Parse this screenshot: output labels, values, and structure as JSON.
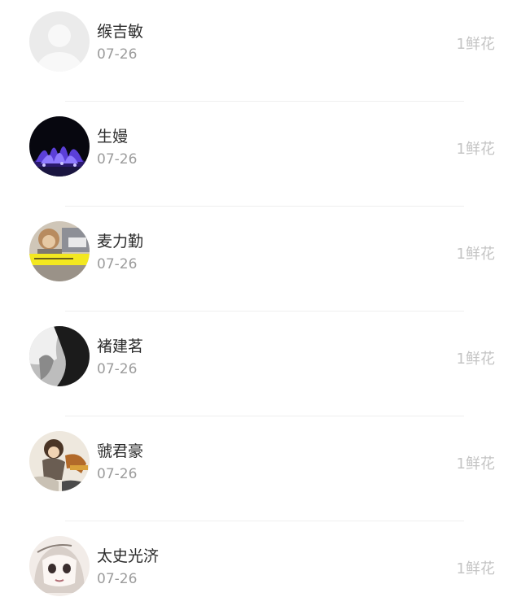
{
  "list": {
    "items": [
      {
        "name": "缑吉敏",
        "date": "07-26",
        "flowers": "1鲜花",
        "avatar": "default-avatar-icon"
      },
      {
        "name": "生嫚",
        "date": "07-26",
        "flowers": "1鲜花",
        "avatar": "fountain-night-avatar"
      },
      {
        "name": "麦力勤",
        "date": "07-26",
        "flowers": "1鲜花",
        "avatar": "photo-avatar-yellow-caption"
      },
      {
        "name": "褚建茗",
        "date": "07-26",
        "flowers": "1鲜花",
        "avatar": "grayscale-sketch-avatar"
      },
      {
        "name": "虢君豪",
        "date": "07-26",
        "flowers": "1鲜花",
        "avatar": "anime-character-avatar"
      },
      {
        "name": "太史光济",
        "date": "07-26",
        "flowers": "1鲜花",
        "avatar": "manga-girl-avatar"
      }
    ]
  },
  "colors": {
    "name_text": "#2b2b2b",
    "date_text": "#9c9c9c",
    "flowers_text": "#c4c4c4",
    "divider": "#efefef"
  }
}
